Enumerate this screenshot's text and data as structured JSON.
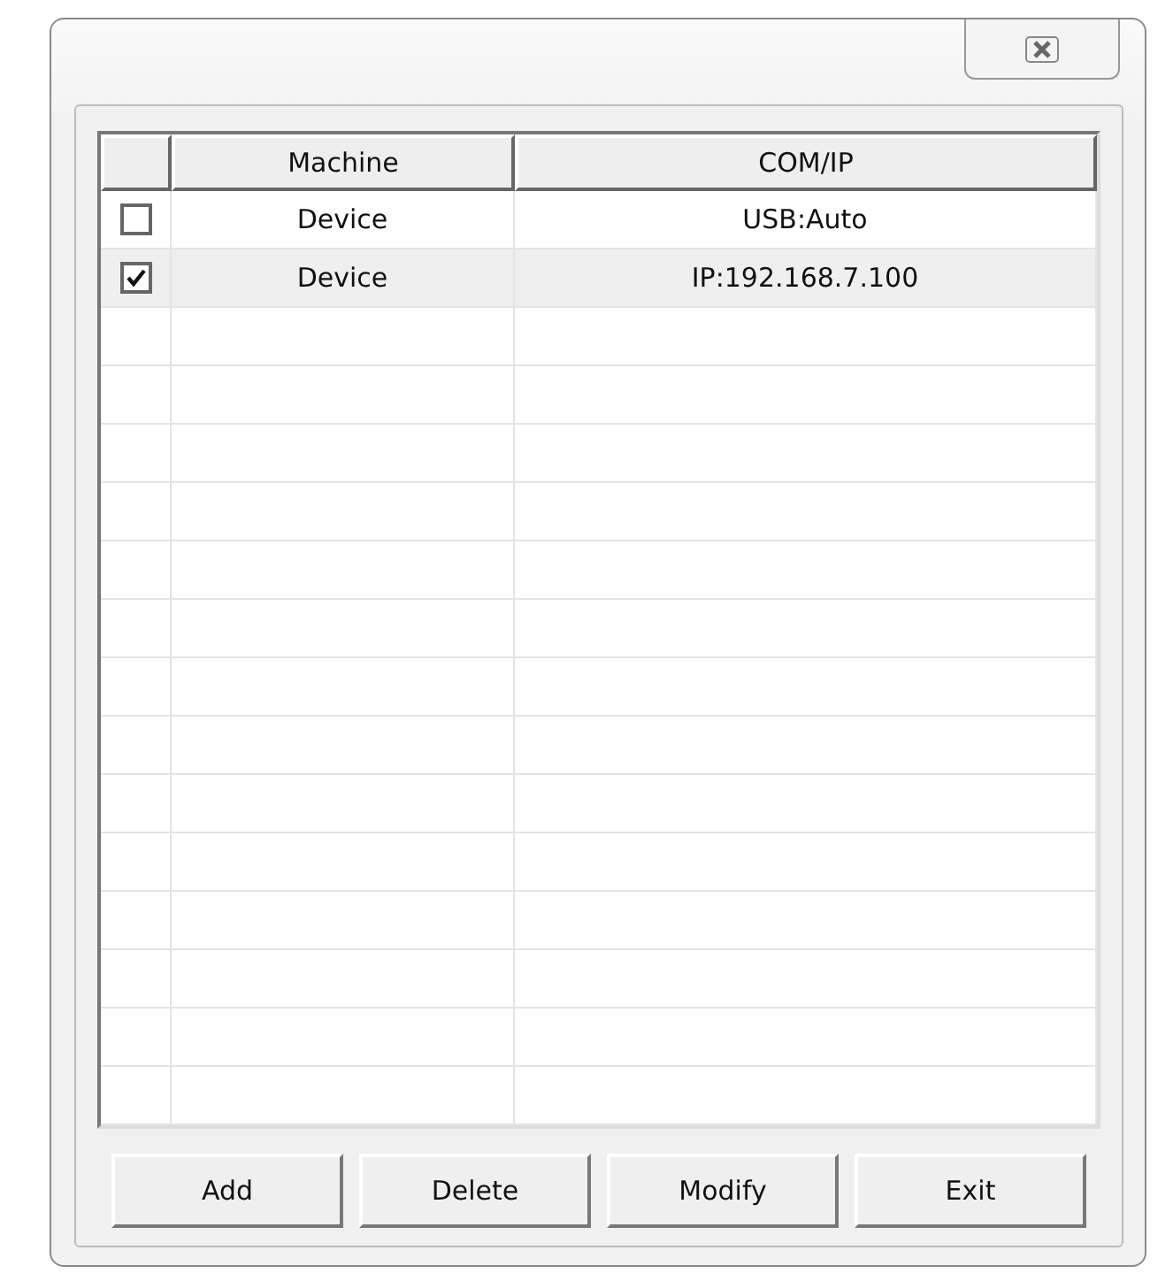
{
  "table": {
    "columns": [
      "Machine",
      "COM/IP"
    ],
    "rows": [
      {
        "checked": false,
        "selected": false,
        "machine": "Device",
        "com_ip": "USB:Auto"
      },
      {
        "checked": true,
        "selected": true,
        "machine": "Device",
        "com_ip": "IP:192.168.7.100"
      }
    ]
  },
  "buttons": [
    "Add",
    "Delete",
    "Modify",
    "Exit"
  ]
}
